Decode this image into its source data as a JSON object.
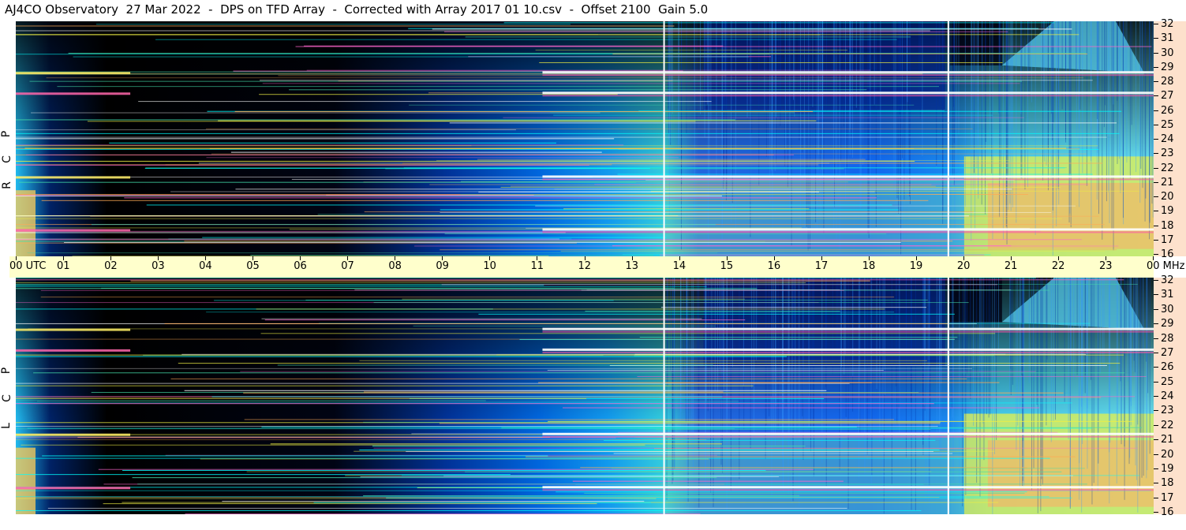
{
  "title": "AJ4CO Observatory  27 Mar 2022  -  DPS on TFD Array  -  Corrected with Array 2017 01 10.csv  -  Offset 2100  Gain 5.0",
  "panels": [
    {
      "polarization": [
        "R",
        "C",
        "P"
      ]
    },
    {
      "polarization": [
        "L",
        "C",
        "P"
      ]
    }
  ],
  "time_axis": {
    "labels": [
      "00  UTC",
      "01",
      "02",
      "03",
      "04",
      "05",
      "06",
      "07",
      "08",
      "09",
      "10",
      "11",
      "12",
      "13",
      "14",
      "15",
      "16",
      "17",
      "18",
      "19",
      "20",
      "21",
      "22",
      "23",
      "00 MHz"
    ]
  },
  "colors": {
    "panel_background": "#000000",
    "time_bar": "#ffffcc",
    "freq_axis": "#fde1cc",
    "colormap": [
      "#000000",
      "#001a66",
      "#0033cc",
      "#1166ee",
      "#22aaff",
      "#44dddd",
      "#88ee88",
      "#eeee44",
      "#ffaa66",
      "#ff66aa",
      "#ffffff"
    ]
  },
  "chart_data": {
    "type": "heatmap",
    "x_range_hours_utc": [
      0,
      24
    ],
    "y_range_mhz": [
      16,
      32
    ],
    "x_ticks": [
      "00",
      "01",
      "02",
      "03",
      "04",
      "05",
      "06",
      "07",
      "08",
      "09",
      "10",
      "11",
      "12",
      "13",
      "14",
      "15",
      "16",
      "17",
      "18",
      "19",
      "20",
      "21",
      "22",
      "23",
      "00"
    ],
    "y_ticks": [
      32,
      31,
      30,
      29,
      28,
      27,
      26,
      25,
      24,
      23,
      22,
      21,
      20,
      19,
      18,
      17,
      16
    ],
    "y_unit": "MHz",
    "x_unit": "UTC",
    "vertical_markers_hours": [
      13.65,
      19.65
    ],
    "interference_bands_mhz": [
      27.1,
      21.4,
      17.8,
      28.5
    ]
  }
}
